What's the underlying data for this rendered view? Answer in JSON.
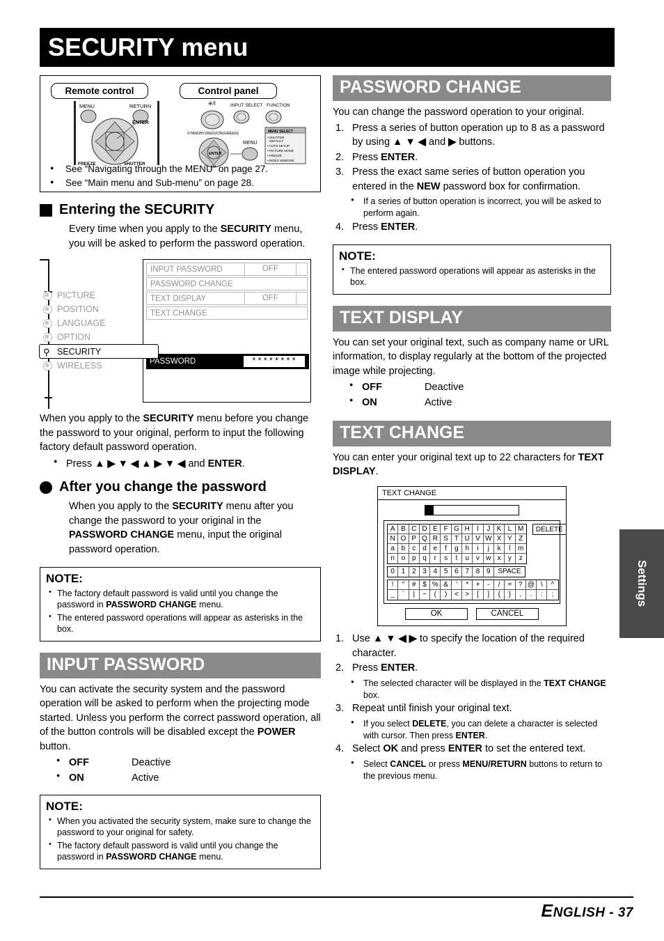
{
  "page": {
    "title": "SECURITY menu",
    "footer": "NGLISH - 37",
    "footer_cap": "E",
    "side_tab": "Settings"
  },
  "refbox": {
    "remote_label": "Remote control",
    "panel_label": "Control panel",
    "remote_keys": [
      "MENU",
      "RETURN",
      "ENTER",
      "FREEZE",
      "SHUTTER"
    ],
    "panel_keys": [
      "INPUT SELECT",
      "FUNCTION",
      "MENU",
      "ENTER",
      "STANDBY(RED)/ON(GREEN)"
    ],
    "panel_popup_title": "MENU SELECT",
    "panel_popup_items": [
      "SHUTTER",
      "DEFAULT",
      "AUTO SETUP",
      "PICTURE MODE",
      "FREEZE",
      "INDEX WINDOW"
    ],
    "notes": [
      "See “Navigating through the MENU” on page 27.",
      "See “Main menu and Sub-menu” on page 28."
    ]
  },
  "entering": {
    "heading": "Entering the SECURITY",
    "intro_1": "Every time when you apply to the ",
    "intro_b": "SECURITY",
    "intro_2": " menu, you will be asked to perform the password operation."
  },
  "osd": {
    "menu_items": [
      {
        "label": "PICTURE",
        "selected": false
      },
      {
        "label": "POSITION",
        "selected": false
      },
      {
        "label": "LANGUAGE",
        "selected": false
      },
      {
        "label": "OPTION",
        "selected": false
      },
      {
        "label": "SECURITY",
        "selected": true
      },
      {
        "label": "WIRELESS",
        "selected": false
      }
    ],
    "rows": [
      {
        "label": "INPUT PASSWORD",
        "value": "OFF",
        "has_value": true
      },
      {
        "label": "PASSWORD CHANGE",
        "value": "",
        "has_value": false
      },
      {
        "label": "TEXT DISPLAY",
        "value": "OFF",
        "has_value": true
      },
      {
        "label": "TEXT CHANGE",
        "value": "",
        "has_value": false
      }
    ],
    "password_label": "PASSWORD",
    "password_value": "********"
  },
  "before_change": {
    "p1_a": "When you apply to the ",
    "p1_b": "SECURITY",
    "p1_c": " menu before you change the password to your original, perform to input the following factory default password operation.",
    "bullet_pre": "Press ",
    "bullet_arrows": "▲ ▶ ▼ ◀ ▲ ▶ ▼ ◀",
    "bullet_post_b": "ENTER",
    "bullet_and": " and ",
    "bullet_end": "."
  },
  "after_change": {
    "heading": "After you change the password",
    "p_a": "When you apply to the ",
    "p_b": "SECURITY",
    "p_c": " menu after you change the password to your original in the ",
    "p_d": "PASSWORD CHANGE",
    "p_e": " menu, input the original password operation."
  },
  "note_left_1": {
    "title": "NOTE:",
    "items": [
      {
        "pre": "The factory default password is valid until you change the password in ",
        "bold": "PASSWORD CHANGE",
        "post": " menu."
      },
      {
        "pre": "The entered password operations will appear as asterisks in the box.",
        "bold": "",
        "post": ""
      }
    ]
  },
  "input_password": {
    "heading": "INPUT PASSWORD",
    "body_a": "You can activate the security system and the password operation will be asked to perform when the projecting mode started. Unless you perform the correct password operation, all of the button controls will be disabled except the ",
    "body_b": "POWER",
    "body_c": " button.",
    "options": [
      {
        "key": "OFF",
        "val": "Deactive"
      },
      {
        "key": "ON",
        "val": "Active"
      }
    ]
  },
  "note_left_2": {
    "title": "NOTE:",
    "items": [
      {
        "pre": "When you activated the security system, make sure to change the password to your original for safety.",
        "bold": "",
        "post": ""
      },
      {
        "pre": "The factory default password is valid until you change the password in ",
        "bold": "PASSWORD CHANGE",
        "post": " menu."
      }
    ]
  },
  "password_change": {
    "heading": "PASSWORD CHANGE",
    "intro": "You can change the password operation to your original.",
    "steps": [
      {
        "pre": "Press a series of button operation up to 8 as a password by using ",
        "arrows": "▲ ▼ ◀",
        "mid": " and ",
        "arrow2": "▶",
        "post": " buttons.",
        "bold": "",
        "tail": ""
      },
      {
        "pre": "Press ",
        "arrows": "",
        "mid": "",
        "arrow2": "",
        "post": ".",
        "bold": "ENTER",
        "tail": ""
      },
      {
        "pre": "Press the exact same series of button operation you entered in the ",
        "arrows": "",
        "mid": "",
        "arrow2": "",
        "post": " password box for confirmation.",
        "bold": "NEW",
        "tail": ""
      },
      {
        "pre": "Press ",
        "arrows": "",
        "mid": "",
        "arrow2": "",
        "post": ".",
        "bold": "ENTER",
        "tail": ""
      }
    ],
    "sub_bullet": "If a series of button operation is incorrect, you will be asked to perform again."
  },
  "note_right_1": {
    "title": "NOTE:",
    "items": [
      {
        "pre": "The entered password operations will appear as asterisks in the box.",
        "bold": "",
        "post": ""
      }
    ]
  },
  "text_display": {
    "heading": "TEXT DISPLAY",
    "body": "You can set your original text, such as company name or URL information, to display regularly at the bottom of the projected image while projecting.",
    "options": [
      {
        "key": "OFF",
        "val": "Deactive"
      },
      {
        "key": "ON",
        "val": "Active"
      }
    ]
  },
  "text_change": {
    "heading": "TEXT CHANGE",
    "body_a": "You can enter your original text up to 22 characters for ",
    "body_b": "TEXT DISPLAY",
    "body_c": ".",
    "osd_title": "TEXT CHANGE",
    "delete_label": "DELETE",
    "space_label": "SPACE",
    "ok_label": "OK",
    "cancel_label": "CANCEL",
    "keyboard": {
      "alpha": [
        [
          "A",
          "B",
          "C",
          "D",
          "E",
          "F",
          "G",
          "H",
          "I",
          "J",
          "K",
          "L",
          "M"
        ],
        [
          "N",
          "O",
          "P",
          "Q",
          "R",
          "S",
          "T",
          "U",
          "V",
          "W",
          "X",
          "Y",
          "Z"
        ],
        [
          "a",
          "b",
          "c",
          "d",
          "e",
          "f",
          "g",
          "h",
          "i",
          "j",
          "k",
          "l",
          "m"
        ],
        [
          "n",
          "o",
          "p",
          "q",
          "r",
          "s",
          "t",
          "u",
          "v",
          "w",
          "x",
          "y",
          "z"
        ]
      ],
      "numbers": [
        "0",
        "1",
        "2",
        "3",
        "4",
        "5",
        "6",
        "7",
        "8",
        "9"
      ],
      "symbols": [
        [
          "!",
          "\"",
          "#",
          "$",
          "%",
          "&",
          "'",
          "*",
          "+",
          "-",
          "/",
          "=",
          "?",
          "@",
          "\\",
          "^"
        ],
        [
          "_",
          "`",
          "|",
          "~",
          "(",
          ")",
          "<",
          ">",
          "[",
          "]",
          "{",
          "}",
          ",",
          ".",
          ":",
          ";"
        ]
      ]
    },
    "steps": [
      {
        "pre": "Use ",
        "arrows": "▲ ▼ ◀ ▶",
        "post": " to specify the location of the required character."
      },
      {
        "pre": "Press ",
        "bold": "ENTER",
        "post": "."
      },
      {
        "pre": "Repeat until finish your original text.",
        "post": ""
      },
      {
        "pre": "Select ",
        "bold": "OK",
        "post": " to set the entered text."
      }
    ],
    "sub_bullets": [
      {
        "pre": "The selected character will be displayed in the ",
        "bold": "TEXT CHANGE",
        "post": " box."
      },
      {
        "pre": "If you select ",
        "bold": "DELETE",
        "post": ", you can delete a character is selected with cursor. Then press ",
        "bold2": "ENTER",
        "post2": "."
      },
      {
        "pre": "Select ",
        "bold": "CANCEL",
        "post": " or press ",
        "bold2": "MENU/RETURN",
        "post2": " buttons to return to the previous menu."
      }
    ]
  },
  "colors": {
    "band": "#8a8a8a",
    "title_bar": "#000000",
    "side_tab": "#4a4a4a"
  }
}
